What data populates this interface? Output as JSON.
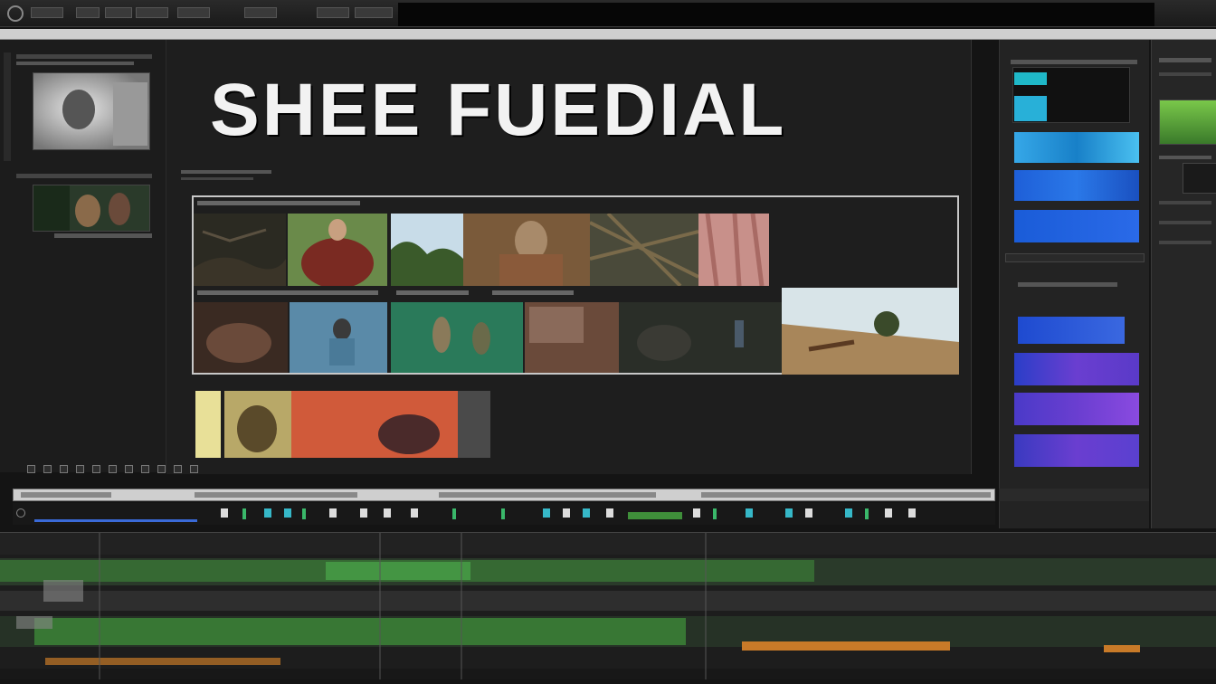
{
  "toolbar": {
    "chips": [
      "",
      "",
      "",
      "",
      "",
      "",
      "",
      ""
    ]
  },
  "menubar": {
    "items": [
      "",
      "",
      "",
      ""
    ]
  },
  "viewer": {
    "title": "SHEE FUEDIAL"
  },
  "colors": {
    "background": "#141414",
    "panel": "#1e1e1e",
    "menubar": "#cfcfcf",
    "title_text": "#f2f2f2",
    "clip_green": "#3f8f3a",
    "clip_orange": "#c87a28",
    "swatch_blue": "#1e5fd8",
    "swatch_purple": "#6a3ed0"
  },
  "icons": [
    "app-icon",
    "play-icon",
    "marker-icon"
  ]
}
